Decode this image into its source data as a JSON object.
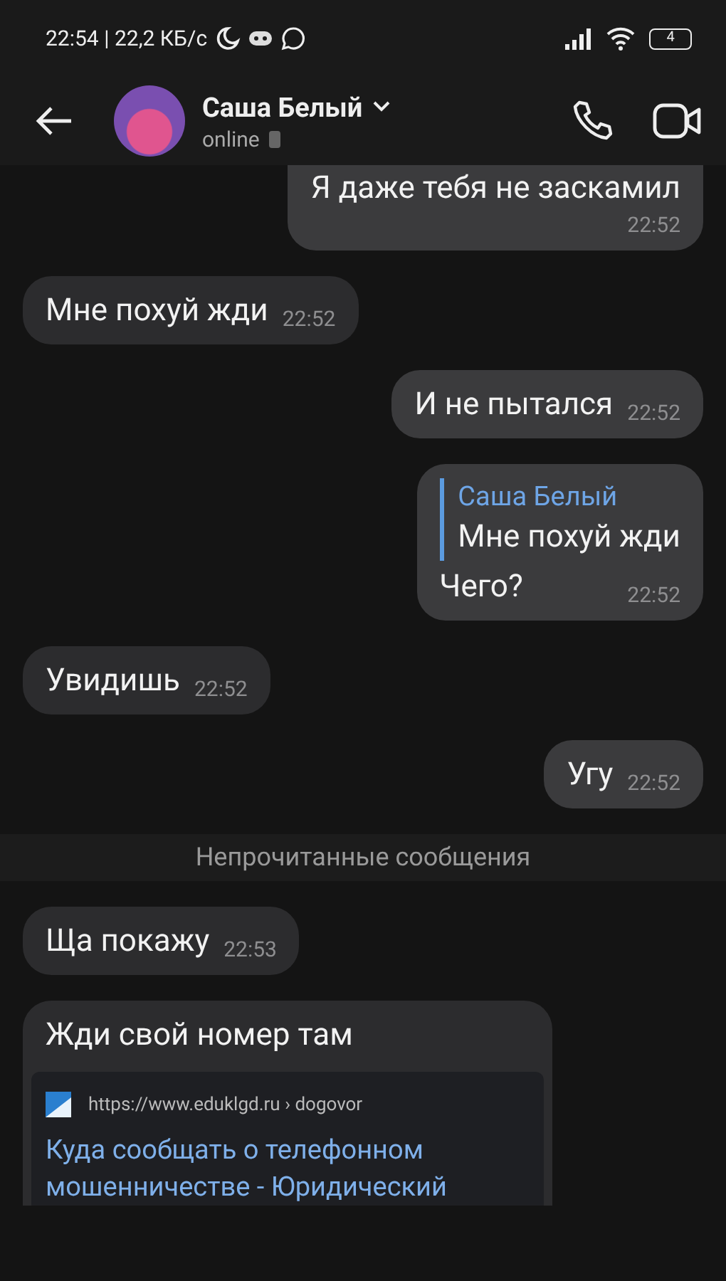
{
  "status_bar": {
    "time": "22:54 | 22,2 КБ/с",
    "battery": "4"
  },
  "header": {
    "name": "Саша Белый",
    "status": "online"
  },
  "messages": [
    {
      "kind": "text",
      "outgoing": true,
      "text": "Я даже тебя не заскамил",
      "time": "22:52"
    },
    {
      "kind": "text",
      "outgoing": false,
      "text": "Мне похуй жди",
      "time": "22:52"
    },
    {
      "kind": "text",
      "outgoing": true,
      "text": "И не пытался",
      "time": "22:52"
    },
    {
      "kind": "reply",
      "outgoing": true,
      "reply_author": "Саша Белый",
      "reply_text": "Мне похуй жди",
      "text": "Чего?",
      "time": "22:52"
    },
    {
      "kind": "text",
      "outgoing": false,
      "text": "Увидишь",
      "time": "22:52"
    },
    {
      "kind": "text",
      "outgoing": true,
      "text": "Угу",
      "time": "22:52"
    },
    {
      "kind": "divider",
      "text": "Непрочитанные сообщения"
    },
    {
      "kind": "text",
      "outgoing": false,
      "text": "Ща покажу",
      "time": "22:53"
    },
    {
      "kind": "link",
      "outgoing": false,
      "text": "Жди свой номер там",
      "url": "https://www.eduklgd.ru › dogovor",
      "title": "Куда сообщать о телефонном мошенничестве - Юридический"
    }
  ]
}
